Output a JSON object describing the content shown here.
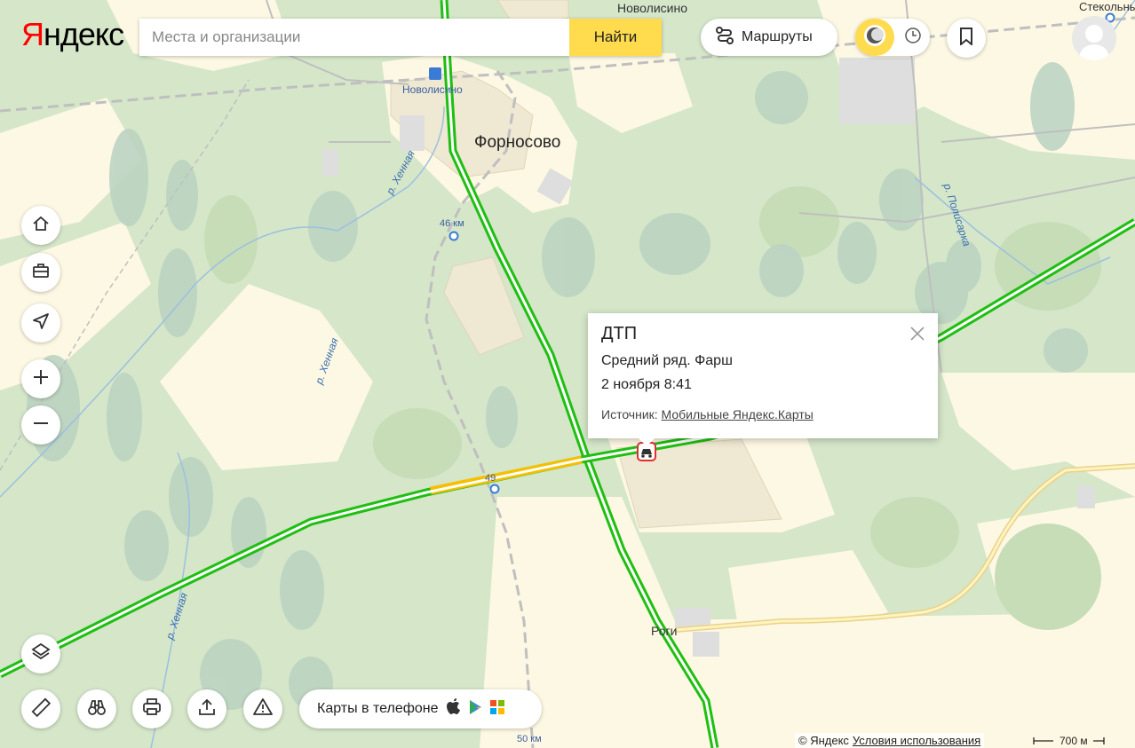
{
  "logo": {
    "first": "Я",
    "rest": "ндекс"
  },
  "search": {
    "placeholder": "Места и организации",
    "button": "Найти"
  },
  "header": {
    "routes_label": "Маршруты"
  },
  "map_labels": {
    "novolisino_top": "Новолисино",
    "novolisino_station": "Новолисино",
    "fornosovo": "Форносово",
    "stekolny": "Стекольны",
    "km46": "46 км",
    "km50": "50 км",
    "km_near_junction": "49",
    "river_hennaya_1": "р. Хенная",
    "river_hennaya_2": "р. Хенная",
    "river_hennaya_3": "р. Хенная",
    "river_polisarka": "р. Полисарка",
    "rogi": "Роги"
  },
  "popup": {
    "title": "ДТП",
    "description": "Средний ряд. Фарш",
    "date": "2 ноября 8:41",
    "source_label": "Источник:",
    "source_link": "Мобильные Яндекс.Карты"
  },
  "phone_promo": {
    "label": "Карты в телефоне"
  },
  "footer": {
    "copyright": "© Яндекс",
    "terms": "Условия использования",
    "scale": "700 м"
  },
  "colors": {
    "traffic_green": "#1fbf12",
    "traffic_yellow": "#f5c000",
    "accent": "#ffdb4d",
    "logo_red": "#ff0000"
  }
}
